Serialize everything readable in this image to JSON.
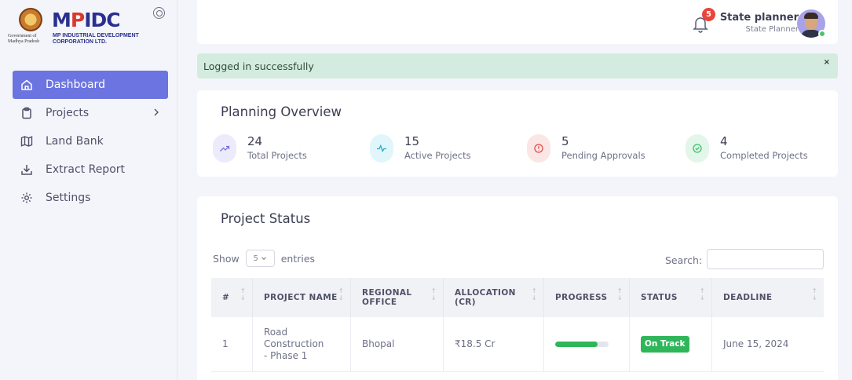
{
  "logo": {
    "word_left": "M",
    "word_p": "P",
    "word_right": "IDC",
    "government_line1": "Government of",
    "government_line2": "Madhya Pradesh",
    "corp_line1": "MP INDUSTRIAL DEVELOPMENT",
    "corp_line2": "CORPORATION LTD."
  },
  "sidebar": {
    "items": [
      {
        "label": "Dashboard",
        "icon": "home-icon",
        "active": true
      },
      {
        "label": "Projects",
        "icon": "clipboard-icon",
        "has_submenu": true
      },
      {
        "label": "Land Bank",
        "icon": "map-icon"
      },
      {
        "label": "Extract Report",
        "icon": "download-icon"
      },
      {
        "label": "Settings",
        "icon": "gear-icon"
      }
    ]
  },
  "header": {
    "notification_count": "5",
    "user_name": "State planner",
    "user_role": "State Planner"
  },
  "alert": {
    "message": "Logged in successfully",
    "close": "×"
  },
  "overview": {
    "title": "Planning Overview",
    "stats": [
      {
        "value": "24",
        "label": "Total Projects",
        "icon": "trending-up-icon",
        "color": "#7b6fe3",
        "bg": "#ecebfb"
      },
      {
        "value": "15",
        "label": "Active Projects",
        "icon": "activity-icon",
        "color": "#2aa9c9",
        "bg": "#e0f6fb"
      },
      {
        "value": "5",
        "label": "Pending Approvals",
        "icon": "alert-circle-icon",
        "color": "#e04a4a",
        "bg": "#fbe6e6"
      },
      {
        "value": "4",
        "label": "Completed Projects",
        "icon": "check-circle-icon",
        "color": "#3cbf6a",
        "bg": "#e3f6ea"
      }
    ]
  },
  "project_status": {
    "title": "Project Status",
    "show_label": "Show",
    "entries_value": "5",
    "entries_label": "entries",
    "search_label": "Search:",
    "search_value": "",
    "columns": [
      "#",
      "PROJECT NAME",
      "REGIONAL OFFICE",
      "ALLOCATION (CR)",
      "PROGRESS",
      "STATUS",
      "DEADLINE"
    ],
    "rows": [
      {
        "index": "1",
        "name": "Road Construction - Phase 1",
        "office": "Bhopal",
        "allocation": "₹18.5 Cr",
        "progress": 0.8,
        "status": "On Track",
        "deadline": "June 15, 2024"
      }
    ]
  },
  "colors": {
    "accent": "#6b74e0",
    "success": "#2fb65a",
    "danger": "#e8453c",
    "alert_bg": "#d3ecdf"
  }
}
